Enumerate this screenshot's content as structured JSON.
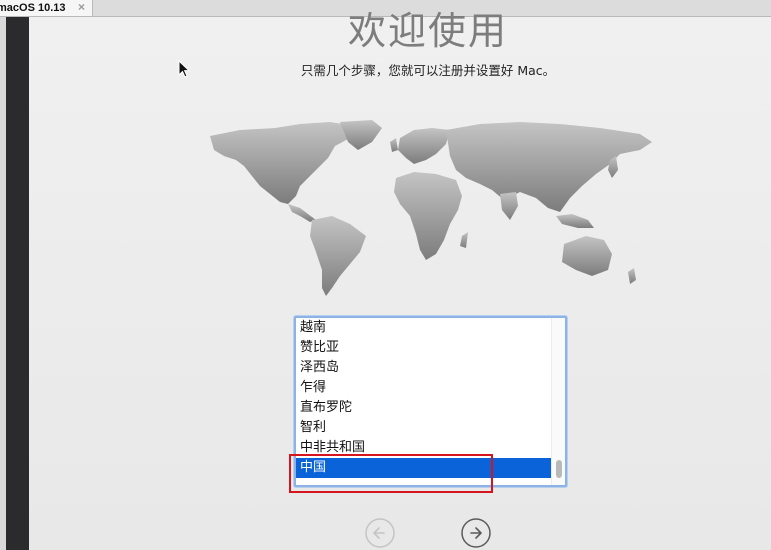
{
  "window": {
    "tab_title": "macOS 10.13",
    "close_glyph": "×"
  },
  "setup": {
    "title": "欢迎使用",
    "subtitle": "只需几个步骤，您就可以注册并设置好 Mac。"
  },
  "country_list": {
    "items": [
      {
        "label": "越南",
        "selected": false
      },
      {
        "label": "赞比亚",
        "selected": false
      },
      {
        "label": "泽西岛",
        "selected": false
      },
      {
        "label": "乍得",
        "selected": false
      },
      {
        "label": "直布罗陀",
        "selected": false
      },
      {
        "label": "智利",
        "selected": false
      },
      {
        "label": "中非共和国",
        "selected": false
      },
      {
        "label": "中国",
        "selected": true
      }
    ]
  },
  "navigation": {
    "back_icon": "back-arrow-icon",
    "next_icon": "forward-arrow-icon"
  },
  "colors": {
    "selection": "#0a63d8",
    "annotation": "#d5141e",
    "list_focus": "#8cb2e6"
  }
}
